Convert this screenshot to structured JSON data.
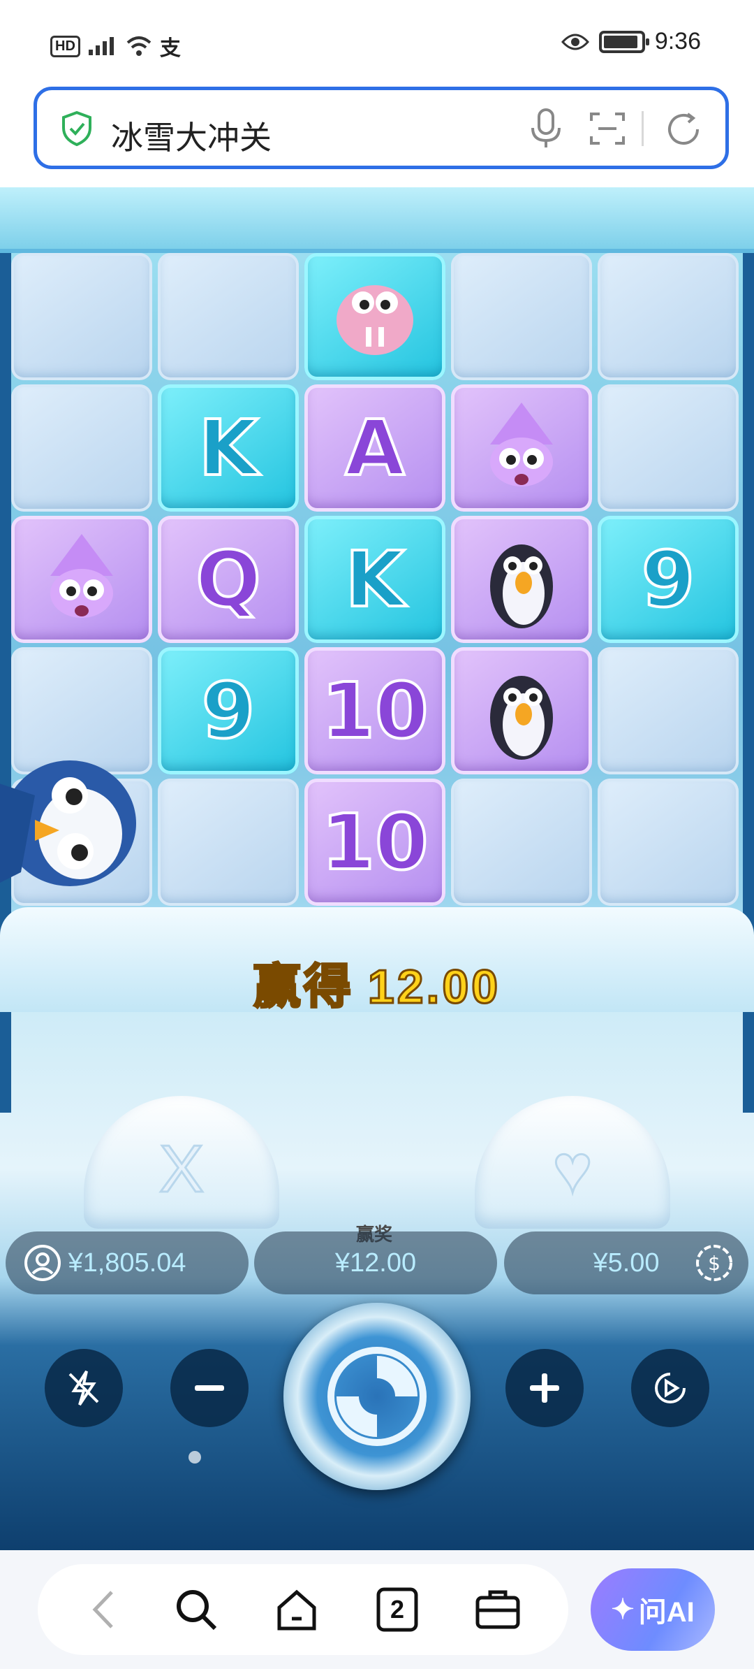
{
  "status_bar": {
    "left_indicators": "HD ⁵⁶",
    "time": "9:36"
  },
  "address_bar": {
    "title": "冰雪大冲关"
  },
  "game": {
    "grid": [
      [
        "ice",
        "ice",
        "walrus",
        "ice",
        "ice"
      ],
      [
        "ice",
        "K",
        "A",
        "squid",
        "ice"
      ],
      [
        "squid",
        "Q",
        "K",
        "penguin",
        "9"
      ],
      [
        "ice",
        "9",
        "10",
        "penguin",
        "ice"
      ],
      [
        "ice",
        "ice",
        "10",
        "ice",
        "ice"
      ]
    ],
    "win_label": "赢得",
    "win_amount": "12.00",
    "igloo_left_symbol": "X",
    "igloo_right_symbol": "♥",
    "balance": "¥1,805.04",
    "win_pill_label": "赢奖",
    "win_pill_value": "¥12.00",
    "bet": "¥5.00"
  },
  "bottom_nav": {
    "tab_count": "2",
    "ai_label": "问AI"
  },
  "colors": {
    "accent_blue": "#2e6fe6",
    "win_text": "#ffd21a",
    "cell_blue": "#22c3df",
    "cell_purple": "#b48ef0"
  }
}
